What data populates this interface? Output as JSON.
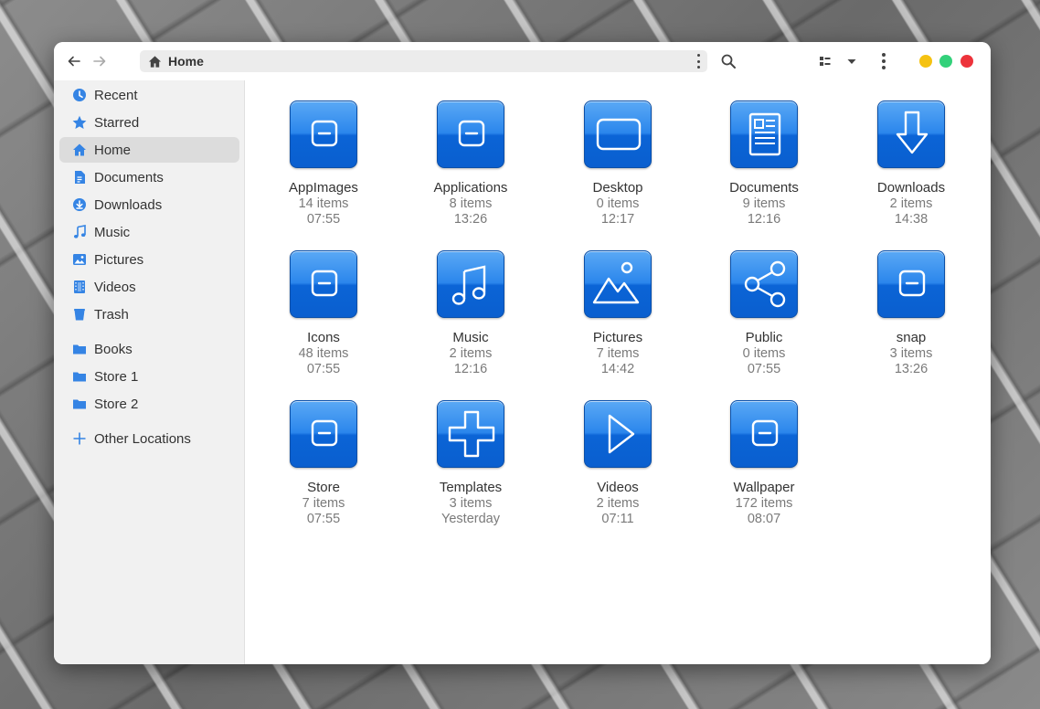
{
  "window": {
    "path_label": "Home"
  },
  "sidebar": {
    "items": [
      {
        "label": "Recent",
        "icon": "clock-icon",
        "active": false
      },
      {
        "label": "Starred",
        "icon": "star-icon",
        "active": false
      },
      {
        "label": "Home",
        "icon": "home-icon",
        "active": true
      },
      {
        "label": "Documents",
        "icon": "document-icon",
        "active": false
      },
      {
        "label": "Downloads",
        "icon": "download-icon",
        "active": false
      },
      {
        "label": "Music",
        "icon": "music-note-icon",
        "active": false
      },
      {
        "label": "Pictures",
        "icon": "image-icon",
        "active": false
      },
      {
        "label": "Videos",
        "icon": "film-icon",
        "active": false
      },
      {
        "label": "Trash",
        "icon": "trash-icon",
        "active": false
      }
    ],
    "bookmarks": [
      {
        "label": "Books",
        "icon": "folder-icon"
      },
      {
        "label": "Store 1",
        "icon": "folder-icon"
      },
      {
        "label": "Store 2",
        "icon": "folder-icon"
      }
    ],
    "other_locations": {
      "label": "Other Locations",
      "icon": "plus-icon"
    }
  },
  "folders": [
    {
      "name": "AppImages",
      "count": "14 items",
      "time": "07:55",
      "emblem": "minus"
    },
    {
      "name": "Applications",
      "count": "8 items",
      "time": "13:26",
      "emblem": "minus"
    },
    {
      "name": "Desktop",
      "count": "0 items",
      "time": "12:17",
      "emblem": "screen"
    },
    {
      "name": "Documents",
      "count": "9 items",
      "time": "12:16",
      "emblem": "document"
    },
    {
      "name": "Downloads",
      "count": "2 items",
      "time": "14:38",
      "emblem": "download"
    },
    {
      "name": "Icons",
      "count": "48 items",
      "time": "07:55",
      "emblem": "minus"
    },
    {
      "name": "Music",
      "count": "2 items",
      "time": "12:16",
      "emblem": "music"
    },
    {
      "name": "Pictures",
      "count": "7 items",
      "time": "14:42",
      "emblem": "picture"
    },
    {
      "name": "Public",
      "count": "0 items",
      "time": "07:55",
      "emblem": "share"
    },
    {
      "name": "snap",
      "count": "3 items",
      "time": "13:26",
      "emblem": "minus"
    },
    {
      "name": "Store",
      "count": "7 items",
      "time": "07:55",
      "emblem": "minus"
    },
    {
      "name": "Templates",
      "count": "3 items",
      "time": "Yesterday",
      "emblem": "plus"
    },
    {
      "name": "Videos",
      "count": "2 items",
      "time": "07:11",
      "emblem": "play"
    },
    {
      "name": "Wallpaper",
      "count": "172 items",
      "time": "08:07",
      "emblem": "minus"
    }
  ],
  "colors": {
    "accent": "#3584e4",
    "folder_blue": "#1a73e8",
    "close": "#ed333b",
    "maximize": "#33d17a",
    "minimize": "#f5c211"
  }
}
